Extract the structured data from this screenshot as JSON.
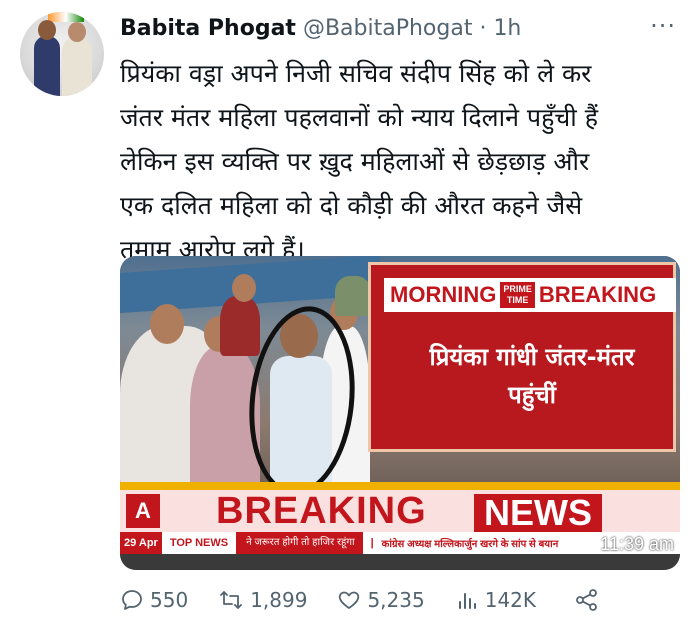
{
  "tweet": {
    "author_name": "Babita Phogat",
    "author_handle": "@BabitaPhogat",
    "separator": " · ",
    "time": "1h",
    "more": "···",
    "lines": [
      "प्रियंका वड्रा अपने निजी सचिव संदीप सिंह को ले कर",
      "जंतर मंतर महिला पहलवानों को न्याय दिलाने पहुँची हैं",
      "लेकिन इस व्यक्ति पर ख़ुद महिलाओं से छेड़छाड़ और",
      "एक दलित महिला को दो कौड़ी की औरत कहने जैसे",
      "तमाम आरोप लगे हैं।"
    ]
  },
  "media": {
    "banner_morning": "MORNING",
    "banner_prime_1": "PRIME",
    "banner_prime_2": "TIME",
    "banner_breaking": "BREAKING",
    "red_text_1": "प्रियंका गांधी जंतर-मंतर",
    "red_text_2": "पहुंचीं",
    "logo": "A",
    "breaking": "BREAKING",
    "news": "NEWS",
    "date": "29 Apr",
    "top_news": "TOP NEWS",
    "ticker_1": "ने जरूरत होगी तो हाजिर रहूंगा",
    "ticker_2": "कांग्रेस अध्यक्ष मल्लिकार्जुन खरगे के सांप से बयान",
    "time": "11:39 am"
  },
  "actions": {
    "replies": "550",
    "retweets": "1,899",
    "likes": "5,235",
    "views": "142K"
  },
  "colors": {
    "text": "#0f1419",
    "muted": "#536471",
    "news_red": "#c3151c"
  }
}
